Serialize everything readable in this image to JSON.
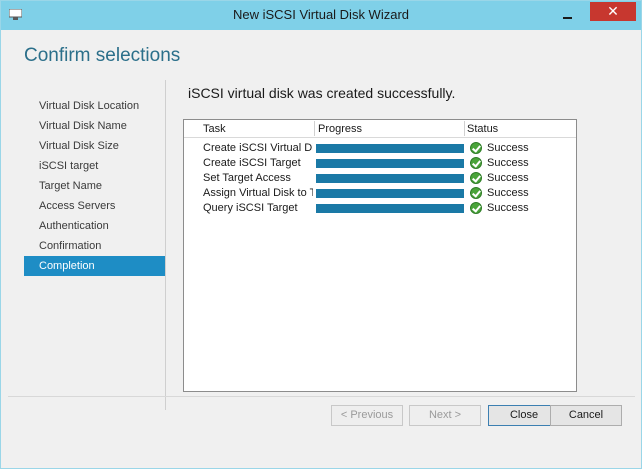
{
  "window": {
    "title": "New iSCSI Virtual Disk Wizard",
    "close_glyph": "✕"
  },
  "page": {
    "heading": "Confirm selections",
    "result_message": "iSCSI virtual disk was created successfully."
  },
  "nav": {
    "items": [
      {
        "label": "Virtual Disk Location"
      },
      {
        "label": "Virtual Disk Name"
      },
      {
        "label": "Virtual Disk Size"
      },
      {
        "label": "iSCSI target"
      },
      {
        "label": "Target Name"
      },
      {
        "label": "Access Servers"
      },
      {
        "label": "Authentication"
      },
      {
        "label": "Confirmation"
      },
      {
        "label": "Completion",
        "active": true
      }
    ]
  },
  "progress_table": {
    "columns": [
      "Task",
      "Progress",
      "Status"
    ],
    "rows": [
      {
        "task": "Create iSCSI Virtual Disk",
        "progress": 1.0,
        "status": "Success"
      },
      {
        "task": "Create iSCSI Target",
        "progress": 1.0,
        "status": "Success"
      },
      {
        "task": "Set Target Access",
        "progress": 1.0,
        "status": "Success"
      },
      {
        "task": "Assign Virtual Disk to Targ",
        "progress": 1.0,
        "status": "Success"
      },
      {
        "task": "Query iSCSI Target",
        "progress": 1.0,
        "status": "Success"
      }
    ]
  },
  "buttons": {
    "previous": "< Previous",
    "next": "Next >",
    "close": "Close",
    "cancel": "Cancel"
  },
  "colors": {
    "accent": "#1e8dc5",
    "progress": "#1a79a6",
    "success": "#4aa43a",
    "heading": "#2b6f8a"
  }
}
